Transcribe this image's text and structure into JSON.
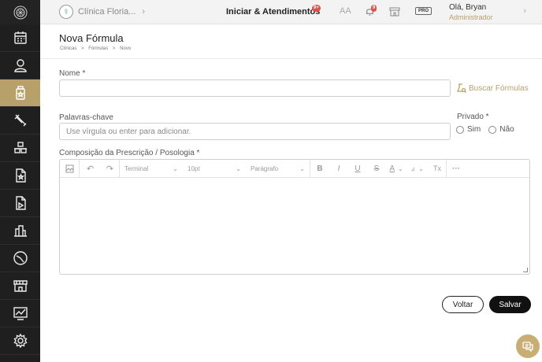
{
  "topbar": {
    "clinic_name": "Clínica Floria...",
    "section_title": "Iniciar & Atendimentos",
    "section_badge": "9+",
    "notification_badge": "9",
    "font_size_icon": "AA",
    "pro_label": "PRO",
    "greeting": "Olá, Bryan",
    "role": "Administrador"
  },
  "sidebar": {
    "items": [
      {
        "name": "calendar-icon"
      },
      {
        "name": "user-icon"
      },
      {
        "name": "bottle-icon",
        "active": true
      },
      {
        "name": "tools-icon"
      },
      {
        "name": "stock-icon"
      },
      {
        "name": "document-star-icon"
      },
      {
        "name": "document-send-icon"
      },
      {
        "name": "building-icon"
      },
      {
        "name": "chart-icon"
      },
      {
        "name": "store-icon"
      },
      {
        "name": "report-icon"
      },
      {
        "name": "gear-icon"
      }
    ]
  },
  "page": {
    "title": "Nova Fórmula",
    "breadcrumb": [
      "Clínicas",
      ">",
      "Fórmulas",
      ">",
      "Novo"
    ]
  },
  "form": {
    "nome_label": "Nome *",
    "nome_value": "",
    "buscar_label": "Buscar Fórmulas",
    "palavras_label": "Palavras-chave",
    "palavras_placeholder": "Use vírgula ou enter para adicionar.",
    "privado_label": "Privado *",
    "privado_options": [
      "Sim",
      "Não"
    ],
    "composicao_label": "Composição da Prescrição / Posologia *"
  },
  "editor": {
    "font_select": "Terminal",
    "size_select": "10pt",
    "block_select": "Parágrafo",
    "bold": "B",
    "italic": "I",
    "underline": "U",
    "strike": "S",
    "text_color": "A",
    "clear_format": "Tx",
    "more": "···"
  },
  "actions": {
    "voltar": "Voltar",
    "salvar": "Salvar"
  },
  "colors": {
    "accent": "#b8a06a",
    "sidebar_bg": "#1f1f1f"
  }
}
